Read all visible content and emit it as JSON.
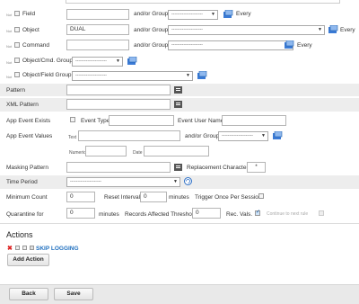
{
  "rows": {
    "field": {
      "not": "Not",
      "label": "Field",
      "or_group": "and/or Group",
      "dash": "---------------------",
      "every": "Every"
    },
    "object": {
      "not": "Not",
      "label": "Object",
      "value": "DUAL",
      "or_group": "and/or Group",
      "dash": "---------------------",
      "every": "Every"
    },
    "command": {
      "not": "Not",
      "label": "Command",
      "or_group": "and/or Group",
      "dash": "---------------------",
      "every": "Every"
    },
    "object_cmd_group": {
      "not": "Not",
      "label": "Object/Cmd. Group",
      "dash": "---------------------"
    },
    "object_field_group": {
      "not": "Not",
      "label": "Object/Field Group",
      "dash": "---------------------"
    }
  },
  "pattern": {
    "label": "Pattern"
  },
  "xml_pattern": {
    "label": "XML Pattern"
  },
  "app_event": {
    "exists_label": "App Event Exists",
    "event_type_label": "Event Type",
    "user_name_label": "Event User Name",
    "values_label": "App Event Values",
    "text_label": "Text",
    "or_group": "and/or Group",
    "dash": "---------------------",
    "numeric_label": "Numeric",
    "date_label": "Date"
  },
  "masking": {
    "label": "Masking Pattern",
    "replacement_label": "Replacement Character",
    "replacement_value": "*"
  },
  "time_period": {
    "label": "Time Period",
    "dash": "---------------------"
  },
  "counts": {
    "min_count_label": "Minimum Count",
    "min_count_value": "0",
    "reset_label": "Reset Interval",
    "reset_value": "0",
    "minutes": "minutes",
    "trigger_label": "Trigger Once Per Session",
    "quarantine_label": "Quarantine for",
    "quarantine_value": "0",
    "minutes2": "minutes",
    "affected_label": "Records Affected Threshold",
    "affected_value": "0",
    "rec_vals_label": "Rec. Vals.",
    "continue_label": "Continue to next rule"
  },
  "actions": {
    "heading": "Actions",
    "item": "SKIP LOGGING",
    "add_label": "Add Action"
  },
  "footer": {
    "back": "Back",
    "save": "Save"
  }
}
